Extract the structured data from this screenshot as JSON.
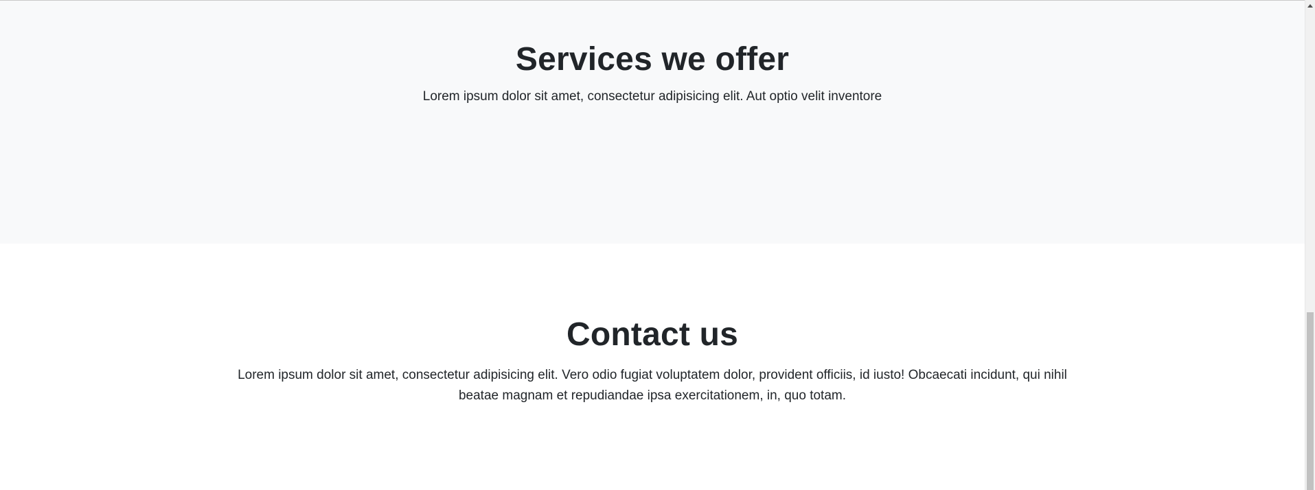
{
  "services": {
    "title": "Services we offer",
    "lead": "Lorem ipsum dolor sit amet, consectetur adipisicing elit. Aut optio velit inventore",
    "background": "#f8f9fa"
  },
  "contact": {
    "title": "Contact us",
    "lead": "Lorem ipsum dolor sit amet, consectetur adipisicing elit. Vero odio fugiat voluptatem dolor, provident officiis, id iusto! Obcaecati incidunt, qui nihil beatae magnam et repudiandae ipsa exercitationem, in, quo totam.",
    "background": "#ffffff"
  },
  "colors": {
    "text": "#212529",
    "scrollbar_track": "#f1f1f1",
    "scrollbar_thumb": "#c1c1c1"
  },
  "icons": {
    "scroll_up": "triangle-up-icon"
  }
}
